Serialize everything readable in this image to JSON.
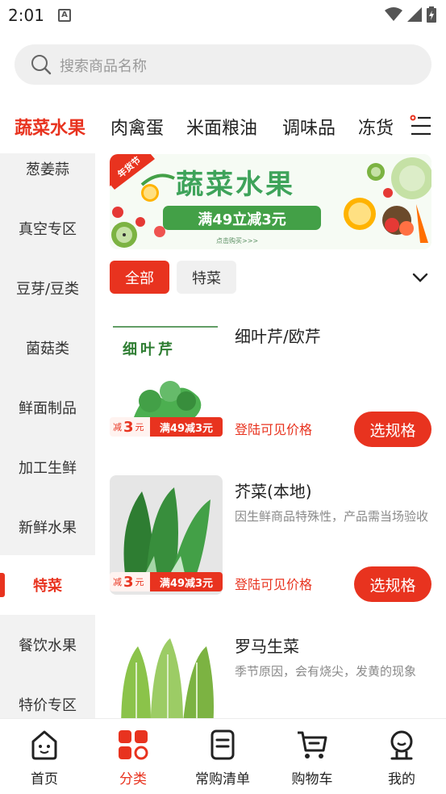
{
  "status_bar": {
    "time": "2:01",
    "notif_letter": "A"
  },
  "search": {
    "placeholder": "搜索商品名称"
  },
  "top_tabs": [
    {
      "label": "蔬菜水果",
      "active": true
    },
    {
      "label": "肉禽蛋",
      "active": false
    },
    {
      "label": "米面粮油",
      "active": false
    },
    {
      "label": "调味品",
      "active": false
    },
    {
      "label": "冻货",
      "active": false
    }
  ],
  "sidebar": {
    "items": [
      "葱姜蒜",
      "真空专区",
      "豆芽/豆类",
      "菌菇类",
      "鲜面制品",
      "加工生鲜",
      "新鲜水果",
      "特菜",
      "餐饮水果",
      "特价专区"
    ],
    "active_index": 7
  },
  "banner": {
    "ribbon": "年货节",
    "title": "蔬菜水果",
    "promo": "满49立减3元",
    "cta": "点击购买>>>"
  },
  "filters": {
    "all": "全部",
    "special": "特菜"
  },
  "promo_tag": {
    "prefix": "减",
    "amount": "3",
    "unit": "元",
    "rule": "满49减3元"
  },
  "products": [
    {
      "name": "细叶芹/欧芹",
      "desc": "",
      "img_label": "细叶芹",
      "price_text": "登陆可见价格",
      "button": "选规格"
    },
    {
      "name": "芥菜(本地)",
      "desc": "因生鲜商品特殊性，产品需当场验收",
      "img_label": "",
      "price_text": "登陆可见价格",
      "button": "选规格"
    },
    {
      "name": "罗马生菜",
      "desc": "季节原因，会有烧尖，发黄的现象",
      "img_label": "",
      "price_text": "",
      "button": ""
    }
  ],
  "bottom_nav": [
    {
      "label": "首页",
      "icon": "home-face-icon",
      "active": false
    },
    {
      "label": "分类",
      "icon": "category-grid-icon",
      "active": true
    },
    {
      "label": "常购清单",
      "icon": "list-icon",
      "active": false
    },
    {
      "label": "购物车",
      "icon": "cart-icon",
      "active": false
    },
    {
      "label": "我的",
      "icon": "profile-icon",
      "active": false
    }
  ],
  "colors": {
    "accent": "#e8331f",
    "sidebar_bg": "#f2f2f2",
    "search_bg": "#efefef",
    "banner_green": "#3ea35a"
  }
}
